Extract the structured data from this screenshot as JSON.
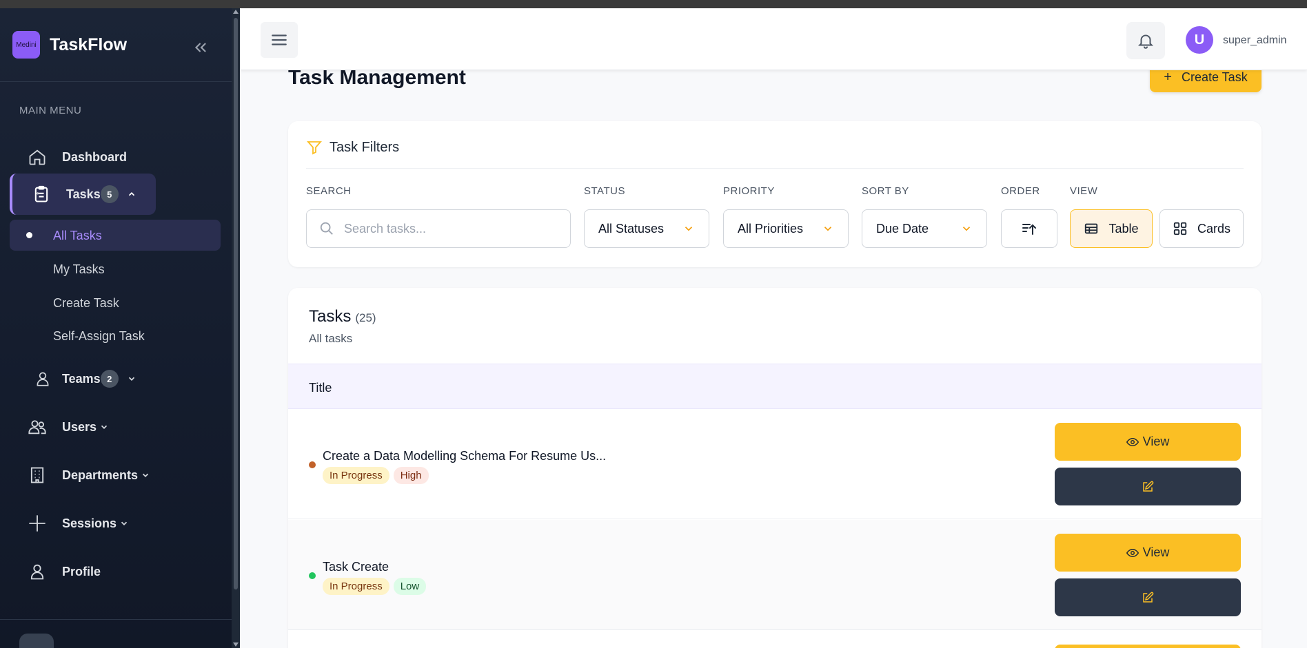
{
  "brand": {
    "logo_text": "Medini",
    "name": "TaskFlow"
  },
  "sidebar": {
    "menu_label": "MAIN MENU",
    "items": [
      {
        "label": "Dashboard"
      },
      {
        "label": "Tasks",
        "badge": "5"
      },
      {
        "label": "Teams",
        "badge": "2"
      },
      {
        "label": "Users"
      },
      {
        "label": "Departments"
      },
      {
        "label": "Sessions"
      },
      {
        "label": "Profile"
      }
    ],
    "task_subitems": [
      {
        "label": "All Tasks"
      },
      {
        "label": "My Tasks"
      },
      {
        "label": "Create Task"
      },
      {
        "label": "Self-Assign Task"
      }
    ]
  },
  "header": {
    "user_initial": "U",
    "user_name": "super_admin"
  },
  "main": {
    "page_title": "Task Management",
    "create_button": "Create Task",
    "filters": {
      "title": "Task Filters",
      "search_label": "SEARCH",
      "search_placeholder": "Search tasks...",
      "status_label": "STATUS",
      "status_value": "All Statuses",
      "priority_label": "PRIORITY",
      "priority_value": "All Priorities",
      "sort_label": "SORT BY",
      "sort_value": "Due Date",
      "order_label": "ORDER",
      "view_label": "VIEW",
      "view_table": "Table",
      "view_cards": "Cards"
    },
    "tasks": {
      "title": "Tasks",
      "count": "(25)",
      "subtitle": "All tasks",
      "column_title": "Title",
      "view_label": "View",
      "rows": [
        {
          "title": "Create a Data Modelling Schema For Resume Us...",
          "status": "In Progress",
          "priority": "High",
          "dot_color": "#c2622a"
        },
        {
          "title": "Task Create",
          "status": "In Progress",
          "priority": "Low",
          "dot_color": "#22c55e"
        }
      ]
    }
  },
  "colors": {
    "accent": "#fbbf24",
    "brand": "#8b5cf6",
    "sidebar_bg": "#1b2436"
  }
}
